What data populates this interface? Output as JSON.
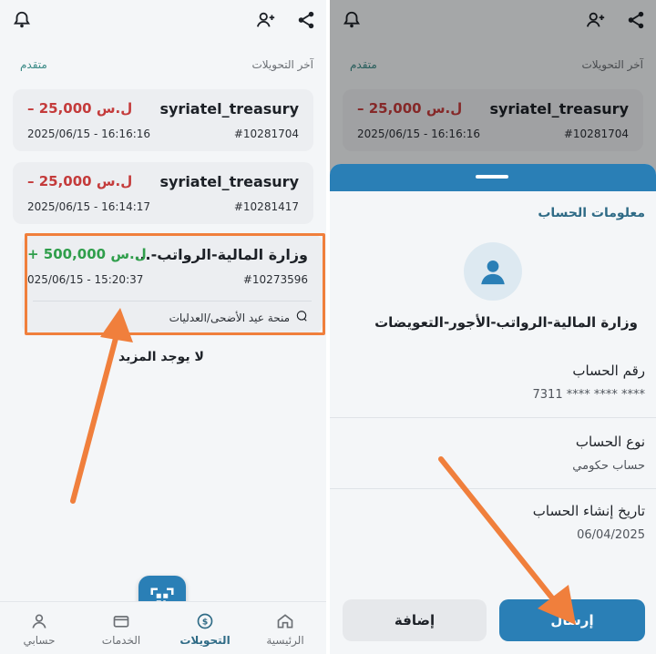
{
  "left": {
    "section_title": "آخر التحويلات",
    "section_action": "متقدم",
    "transactions": [
      {
        "name": "syriatel_treasury",
        "amount": "– 25,000",
        "currency": "ل.س",
        "ref": "#10281704",
        "date": "2025/06/15 - 16:16:16",
        "sign": "neg"
      },
      {
        "name": "syriatel_treasury",
        "amount": "– 25,000",
        "currency": "ل.س",
        "ref": "#10281417",
        "date": "2025/06/15 - 16:14:17",
        "sign": "neg"
      },
      {
        "name": "وزارة المالية-الرواتب-...",
        "amount": "+ 500,000",
        "currency": "ل.س",
        "ref": "#10273596",
        "date": "025/06/15 - 15:20:37",
        "sign": "pos",
        "note": "منحة عيد الأضحى/العدليات"
      }
    ],
    "no_more": "لا يوجد المزيد",
    "nav": {
      "home": "الرئيسية",
      "transfers": "التحويلات",
      "services": "الخدمات",
      "account": "حسابي"
    }
  },
  "right": {
    "header_title": "آخر التحويلات",
    "header_action": "متقدم",
    "preview": {
      "name": "syriatel_treasury",
      "amount": "– 25,000",
      "currency": "ل.س",
      "ref": "#10281704",
      "date": "2025/06/15 - 16:16:16"
    },
    "sheet_title": "معلومات الحساب",
    "account_name": "وزارة المالية-الرواتب-الأجور-التعويضات",
    "fields": [
      {
        "label": "رقم الحساب",
        "value": "7311 **** **** ****"
      },
      {
        "label": "نوع الحساب",
        "value": "حساب حكومي"
      },
      {
        "label": "تاريخ إنشاء الحساب",
        "value": "06/04/2025"
      }
    ],
    "add_button": "إضافة",
    "send_button": "إرسال"
  },
  "colors": {
    "primary": "#2a7fb6",
    "negative": "#c43b3b",
    "positive": "#2f9e4b",
    "highlight": "#f07f3c"
  },
  "icons": {
    "bell": "bell-icon",
    "add_user": "add-user-icon",
    "share": "share-icon"
  }
}
